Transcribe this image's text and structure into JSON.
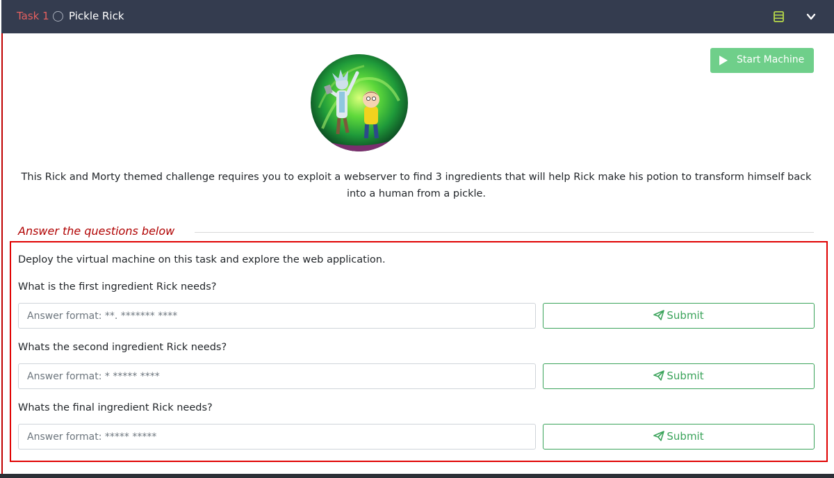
{
  "task": {
    "label": "Task 1",
    "title": "Pickle Rick"
  },
  "header_icons": [
    "notes-icon",
    "chevron-down-icon"
  ],
  "start_machine": {
    "label": "Start Machine",
    "icon": "play-icon",
    "color": "#6fcf8a"
  },
  "description": "This Rick and Morty themed challenge requires you to exploit a webserver to find 3 ingredients that will help Rick make his potion to transform himself back into a human from a pickle.",
  "answers_heading": "Answer the questions below",
  "intro_question": "Deploy the virtual machine on this task and explore the web application.",
  "questions": [
    {
      "text": "What is the first ingredient Rick needs?",
      "placeholder": "Answer format: **. ******* ****",
      "submit_label": "Submit"
    },
    {
      "text": "Whats the second ingredient Rick needs?",
      "placeholder": "Answer format: * ***** ****",
      "submit_label": "Submit"
    },
    {
      "text": "Whats the final ingredient Rick needs?",
      "placeholder": "Answer format: ***** *****",
      "submit_label": "Submit"
    }
  ],
  "colors": {
    "header_bg": "#343c4f",
    "task_label": "#e5605f",
    "accent_red": "#e00000",
    "submit_green": "#3aa35a"
  }
}
